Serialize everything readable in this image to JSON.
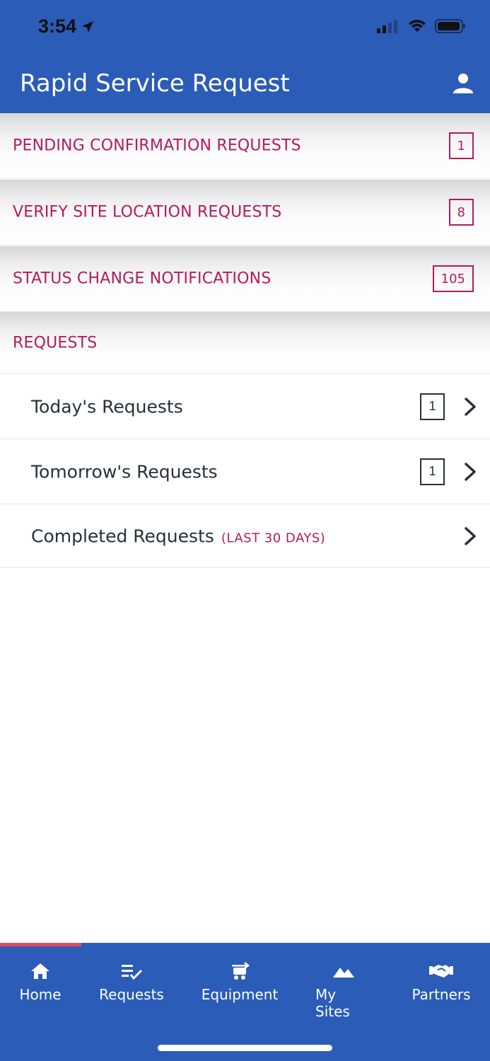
{
  "status_bar": {
    "time": "3:54"
  },
  "header": {
    "title": "Rapid Service Request",
    "profile_icon": "person-icon"
  },
  "sections": [
    {
      "label": "PENDING CONFIRMATION REQUESTS",
      "count": "1"
    },
    {
      "label": "VERIFY SITE LOCATION REQUESTS",
      "count": "8"
    },
    {
      "label": "STATUS CHANGE NOTIFICATIONS",
      "count": "105"
    }
  ],
  "requests": {
    "header": "REQUESTS",
    "items": [
      {
        "label": "Today's Requests",
        "count": "1"
      },
      {
        "label": "Tomorrow's Requests",
        "count": "1"
      },
      {
        "label": "Completed Requests",
        "sublabel": "(LAST 30 DAYS)"
      }
    ]
  },
  "tabs": [
    {
      "label": "Home",
      "icon": "home-icon"
    },
    {
      "label": "Requests",
      "icon": "requests-icon"
    },
    {
      "label": "Equipment",
      "icon": "equipment-icon"
    },
    {
      "label": "My Sites",
      "icon": "mountains-icon"
    },
    {
      "label": "Partners",
      "icon": "handshake-icon"
    }
  ],
  "colors": {
    "primary": "#2a5cb8",
    "accent": "#b51b5a",
    "active_tab": "#e0485d"
  }
}
